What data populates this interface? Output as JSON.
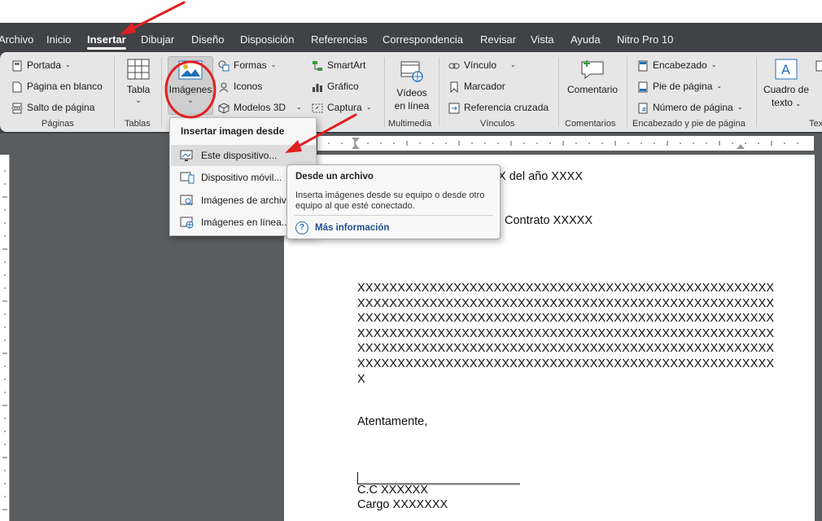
{
  "tabs": [
    {
      "label": "Archivo",
      "active": false
    },
    {
      "label": "Inicio",
      "active": false
    },
    {
      "label": "Insertar",
      "active": true
    },
    {
      "label": "Dibujar",
      "active": false
    },
    {
      "label": "Diseño",
      "active": false
    },
    {
      "label": "Disposición",
      "active": false
    },
    {
      "label": "Referencias",
      "active": false
    },
    {
      "label": "Correspondencia",
      "active": false
    },
    {
      "label": "Revisar",
      "active": false
    },
    {
      "label": "Vista",
      "active": false
    },
    {
      "label": "Ayuda",
      "active": false
    },
    {
      "label": "Nitro Pro 10",
      "active": false
    }
  ],
  "ribbon": {
    "paginas": {
      "items": [
        "Portada",
        "Página en blanco",
        "Salto de página"
      ],
      "label": "Páginas"
    },
    "tablas": {
      "button": "Tabla",
      "label": "Tablas"
    },
    "ilustraciones": {
      "imagenes": "Imágenes",
      "items": [
        "Formas",
        "Iconos",
        "Modelos 3D"
      ],
      "items2": [
        "SmartArt",
        "Gráfico",
        "Captura"
      ]
    },
    "multimedia": {
      "button_line1": "Vídeos",
      "button_line2": "en línea",
      "label": "Multimedia"
    },
    "vinculos": {
      "items": [
        "Vínculo",
        "Marcador",
        "Referencia cruzada"
      ],
      "label": "Vínculos"
    },
    "comentarios": {
      "button": "Comentario",
      "label": "Comentarios"
    },
    "encabezado": {
      "items": [
        "Encabezado",
        "Pie de página",
        "Número de página"
      ],
      "label": "Encabezado y pie de página"
    },
    "texto": {
      "button_line1": "Cuadro de",
      "button_line2": "texto",
      "label": "Tex"
    }
  },
  "menu": {
    "title": "Insertar imagen desde",
    "items": [
      "Este dispositivo...",
      "Dispositivo móvil...",
      "Imágenes de archivo...",
      "Imágenes en línea..."
    ]
  },
  "tooltip": {
    "title": "Desde un archivo",
    "description": "Inserta imágenes desde su equipo o desde otro equipo al que esté conectado.",
    "more": "Más información"
  },
  "document": {
    "line1": "X del año XXXX",
    "line2": "Contrato XXXXX",
    "xlines": [
      "XXXXXXXXXXXXXXXXXXXXXXXXXXXXXXXXXXXXXXXXXXXXXXXXXXXX",
      "XXXXXXXXXXXXXXXXXXXXXXXXXXXXXXXXXXXXXXXXXXXXXXXXXXXX",
      "XXXXXXXXXXXXXXXXXXXXXXXXXXXXXXXXXXXXXXXXXXXXXXXXXXXX",
      "XXXXXXXXXXXXXXXXXXXXXXXXXXXXXXXXXXXXXXXXXXXXXXXXXXXX",
      "XXXXXXXXXXXXXXXXXXXXXXXXXXXXXXXXXXXXXXXXXXXXXXXXXXXX",
      "XXXXXXXXXXXXXXXXXXXXXXXXXXXXXXXXXXXXXXXXXXXXXXXXXXXX",
      "X"
    ],
    "closing": "Atentamente,",
    "cc": "C.C XXXXXX",
    "cargo": "Cargo XXXXXXX"
  },
  "colors": {
    "annotation": "#e02020",
    "link": "#1f4e90",
    "tab_bar": "#404246"
  }
}
